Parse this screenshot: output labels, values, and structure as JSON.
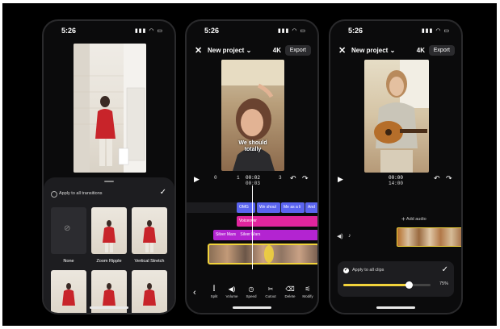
{
  "phone1": {
    "time": "5:26",
    "apply_all_label": "Apply to all transitions",
    "transitions": [
      {
        "label": "None"
      },
      {
        "label": "Zoom Ripple"
      },
      {
        "label": "Vertical Stretch"
      }
    ]
  },
  "phone2": {
    "time": "5:26",
    "project_title": "New project",
    "resolution": "4K",
    "export_label": "Export",
    "caption_text": "We should totally",
    "timecode_current": "00:02",
    "timecode_total": "00:03",
    "ruler_ticks": [
      "0",
      "1",
      "3"
    ],
    "text_tracks": [
      "OMG",
      "We shoul",
      "Me as a li",
      "And"
    ],
    "voiceover_label": "Voiceover",
    "music_tracks": [
      "Silver Mars",
      "Silver Mars"
    ],
    "tools": [
      "Split",
      "Volume",
      "Speed",
      "Cutout",
      "Delete",
      "Modify"
    ]
  },
  "phone3": {
    "time": "5:26",
    "project_title": "New project",
    "resolution": "4K",
    "export_label": "Export",
    "timecode_current": "00:00",
    "timecode_total": "14:00",
    "add_audio_label": "Add audio",
    "apply_volume_label": "Apply to all clips",
    "volume_percent_text": "75%",
    "volume_level": 0.75
  },
  "colors": {
    "accent_yellow": "#f2d33b",
    "text_track_blue": "#5a64f0",
    "voiceover_pink": "#e1259d",
    "music_purple": "#b324d1",
    "panel": "#1d1d20"
  }
}
